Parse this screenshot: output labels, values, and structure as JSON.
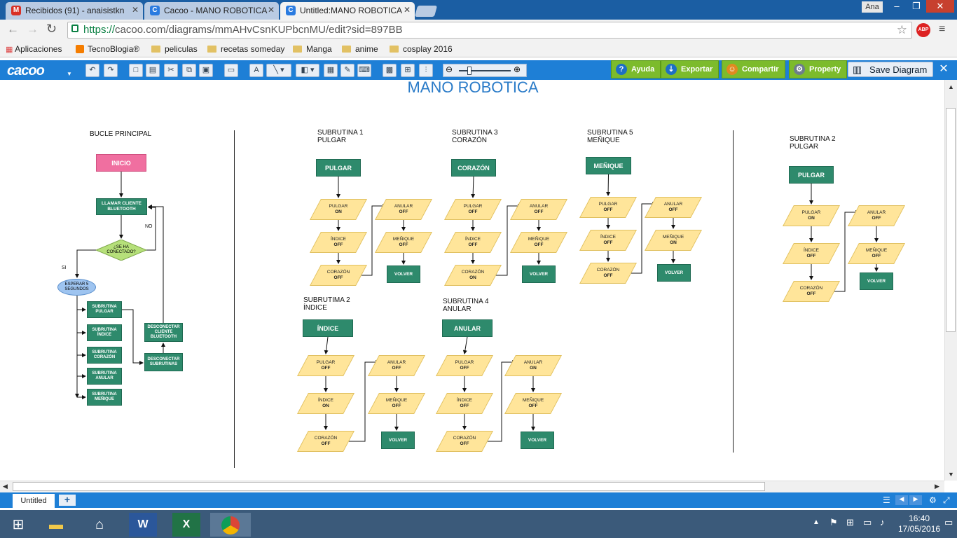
{
  "browser": {
    "tabs": [
      {
        "label": "Recibidos (91) - anaisistkn",
        "icon": "M"
      },
      {
        "label": "Cacoo - MANO ROBOTICA",
        "icon": "C"
      },
      {
        "label": "Untitled:MANO ROBOTICA",
        "icon": "C"
      }
    ],
    "user": "Ana",
    "url_scheme": "https://",
    "url_rest": "cacoo.com/diagrams/mmAHvCsnKUPbcnMU/edit?sid=897BB",
    "adblock": "ABP",
    "bookmarks": [
      "Aplicaciones",
      "TecnoBlogia®",
      "peliculas",
      "recetas someday",
      "Manga",
      "anime",
      "cosplay 2016"
    ]
  },
  "cacoo": {
    "logo": "cacoo",
    "buttons": {
      "help": "Ayuda",
      "export": "Exportar",
      "share": "Compartir",
      "property": "Property",
      "save": "Save Diagram"
    }
  },
  "diagram": {
    "title": "MANO ROBOTICA",
    "main_loop": {
      "heading": "BUCLE PRINCIPAL",
      "start": "INICIO",
      "call": "LLAMAR CLIENTE BLUETOOTH",
      "decision": "¿SE HA CONECTADO?",
      "no": "NO",
      "yes": "SI",
      "wait": "ESPERAR 5 SEGUNDOS",
      "subs": [
        "SUBRUTINA PULGAR",
        "SUBRUTINA ÍNDICE",
        "SUBRUTINA CORAZÓN",
        "SUBRUTINA ANULAR",
        "SUBRUTINA MEÑIQUE"
      ],
      "disconnect_client": "DESCONECTAR CLIENTE BLUETOOTH",
      "disconnect_subs": "DESCONECTAR SUBRUTINAS"
    },
    "subroutines": [
      {
        "heading1": "SUBRUTINA 1",
        "heading2": "PULGAR",
        "box": "PULGAR",
        "p": [
          [
            "PULGAR",
            "ON"
          ],
          [
            "ÍNDICE",
            "OFF"
          ],
          [
            "CORAZÓN",
            "OFF"
          ],
          [
            "ANULAR",
            "OFF"
          ],
          [
            "MEÑIQUE",
            "OFF"
          ]
        ],
        "ret": "VOLVER"
      },
      {
        "heading1": "SUBRUTINA  3",
        "heading2": "CORAZÓN",
        "box": "CORAZÓN",
        "p": [
          [
            "PULGAR",
            "OFF"
          ],
          [
            "ÍNDICE",
            "OFF"
          ],
          [
            "CORAZÓN",
            "ON"
          ],
          [
            "ANULAR",
            "OFF"
          ],
          [
            "MEÑIQUE",
            "OFF"
          ]
        ],
        "ret": "VOLVER"
      },
      {
        "heading1": "SUBRUTINA 5",
        "heading2": "MEÑIQUE",
        "box": "MEÑIQUE",
        "p": [
          [
            "PULGAR",
            "OFF"
          ],
          [
            "ÍNDICE",
            "OFF"
          ],
          [
            "CORAZÓN",
            "OFF"
          ],
          [
            "ANULAR",
            "OFF"
          ],
          [
            "MEÑIQUE",
            "ON"
          ]
        ],
        "ret": "VOLVER"
      },
      {
        "heading1": "SUBRUTIMA 2",
        "heading2": "ÍNDICE",
        "box": "ÍNDICE",
        "p": [
          [
            "PULGAR",
            "OFF"
          ],
          [
            "ÍNDICE",
            "ON"
          ],
          [
            "CORAZÓN",
            "OFF"
          ],
          [
            "ANULAR",
            "OFF"
          ],
          [
            "MEÑIQUE",
            "OFF"
          ]
        ],
        "ret": "VOLVER"
      },
      {
        "heading1": "SUBRUTINA 4",
        "heading2": "ANULAR",
        "box": "ANULAR",
        "p": [
          [
            "PULGAR",
            "OFF"
          ],
          [
            "ÍNDICE",
            "OFF"
          ],
          [
            "CORAZÓN",
            "OFF"
          ],
          [
            "ANULAR",
            "ON"
          ],
          [
            "MEÑIQUE",
            "OFF"
          ]
        ],
        "ret": "VOLVER"
      },
      {
        "heading1": "SUBRUTINA 2",
        "heading2": "PULGAR",
        "box": "PULGAR",
        "p": [
          [
            "PULGAR",
            "ON"
          ],
          [
            "ÍNDICE",
            "OFF"
          ],
          [
            "CORAZÓN",
            "OFF"
          ],
          [
            "ANULAR",
            "OFF"
          ],
          [
            "MEÑIQUE",
            "OFF"
          ]
        ],
        "ret": "VOLVER"
      }
    ]
  },
  "sheet": {
    "tab": "Untitled",
    "add": "+"
  },
  "taskbar": {
    "time": "16:40",
    "date": "17/05/2016"
  }
}
